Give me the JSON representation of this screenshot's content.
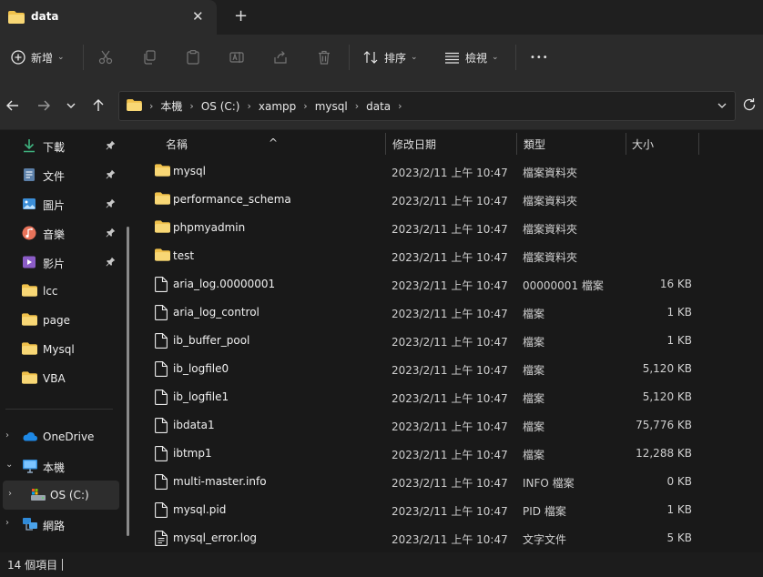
{
  "window": {
    "tab_title": "data",
    "close_glyph": "✕",
    "new_tab_glyph": "+"
  },
  "toolbar": {
    "new_label": "新增",
    "sort_label": "排序",
    "view_label": "檢視",
    "more_glyph": "•••",
    "chevron": "⌄"
  },
  "nav": {
    "breadcrumb": [
      "本機",
      "OS (C:)",
      "xampp",
      "mysql",
      "data"
    ],
    "sep": "›",
    "chevron": "⌄"
  },
  "sidebar": {
    "quick_access": [
      {
        "label": "下載",
        "icon": "download-icon",
        "pinned": true
      },
      {
        "label": "文件",
        "icon": "document-icon",
        "pinned": true
      },
      {
        "label": "圖片",
        "icon": "pictures-icon",
        "pinned": true
      },
      {
        "label": "音樂",
        "icon": "music-icon",
        "pinned": true
      },
      {
        "label": "影片",
        "icon": "video-icon",
        "pinned": true
      },
      {
        "label": "lcc",
        "icon": "folder-icon",
        "pinned": false
      },
      {
        "label": "page",
        "icon": "folder-icon",
        "pinned": false
      },
      {
        "label": "Mysql",
        "icon": "folder-icon",
        "pinned": false
      },
      {
        "label": "VBA",
        "icon": "folder-icon",
        "pinned": false
      }
    ],
    "tree": [
      {
        "label": "OneDrive",
        "icon": "cloud-icon",
        "expander": "›"
      },
      {
        "label": "本機",
        "icon": "computer-icon",
        "expander": "⌄"
      },
      {
        "label": "OS (C:)",
        "icon": "drive-icon",
        "expander": "›",
        "selected": true
      },
      {
        "label": "網路",
        "icon": "network-icon",
        "expander": "›"
      }
    ]
  },
  "list": {
    "columns": {
      "name": "名稱",
      "date": "修改日期",
      "type": "類型",
      "size": "大小"
    },
    "sort_glyph": "^",
    "rows": [
      {
        "name": "mysql",
        "date": "2023/2/11 上午 10:47",
        "type": "檔案資料夾",
        "size": "",
        "icon": "folder-icon"
      },
      {
        "name": "performance_schema",
        "date": "2023/2/11 上午 10:47",
        "type": "檔案資料夾",
        "size": "",
        "icon": "folder-icon"
      },
      {
        "name": "phpmyadmin",
        "date": "2023/2/11 上午 10:47",
        "type": "檔案資料夾",
        "size": "",
        "icon": "folder-icon"
      },
      {
        "name": "test",
        "date": "2023/2/11 上午 10:47",
        "type": "檔案資料夾",
        "size": "",
        "icon": "folder-icon"
      },
      {
        "name": "aria_log.00000001",
        "date": "2023/2/11 上午 10:47",
        "type": "00000001 檔案",
        "size": "16 KB",
        "icon": "file-icon"
      },
      {
        "name": "aria_log_control",
        "date": "2023/2/11 上午 10:47",
        "type": "檔案",
        "size": "1 KB",
        "icon": "file-icon"
      },
      {
        "name": "ib_buffer_pool",
        "date": "2023/2/11 上午 10:47",
        "type": "檔案",
        "size": "1 KB",
        "icon": "file-icon"
      },
      {
        "name": "ib_logfile0",
        "date": "2023/2/11 上午 10:47",
        "type": "檔案",
        "size": "5,120 KB",
        "icon": "file-icon"
      },
      {
        "name": "ib_logfile1",
        "date": "2023/2/11 上午 10:47",
        "type": "檔案",
        "size": "5,120 KB",
        "icon": "file-icon"
      },
      {
        "name": "ibdata1",
        "date": "2023/2/11 上午 10:47",
        "type": "檔案",
        "size": "75,776 KB",
        "icon": "file-icon"
      },
      {
        "name": "ibtmp1",
        "date": "2023/2/11 上午 10:47",
        "type": "檔案",
        "size": "12,288 KB",
        "icon": "file-icon"
      },
      {
        "name": "multi-master.info",
        "date": "2023/2/11 上午 10:47",
        "type": "INFO 檔案",
        "size": "0 KB",
        "icon": "file-icon"
      },
      {
        "name": "mysql.pid",
        "date": "2023/2/11 上午 10:47",
        "type": "PID 檔案",
        "size": "1 KB",
        "icon": "file-icon"
      },
      {
        "name": "mysql_error.log",
        "date": "2023/2/11 上午 10:47",
        "type": "文字文件",
        "size": "5 KB",
        "icon": "text-file-icon"
      }
    ]
  },
  "status": {
    "item_count": "14 個項目"
  },
  "colors": {
    "folder": "#f0c14b",
    "accent": "#4cc2ff",
    "background": "#191919",
    "chrome": "#2b2b2b"
  }
}
